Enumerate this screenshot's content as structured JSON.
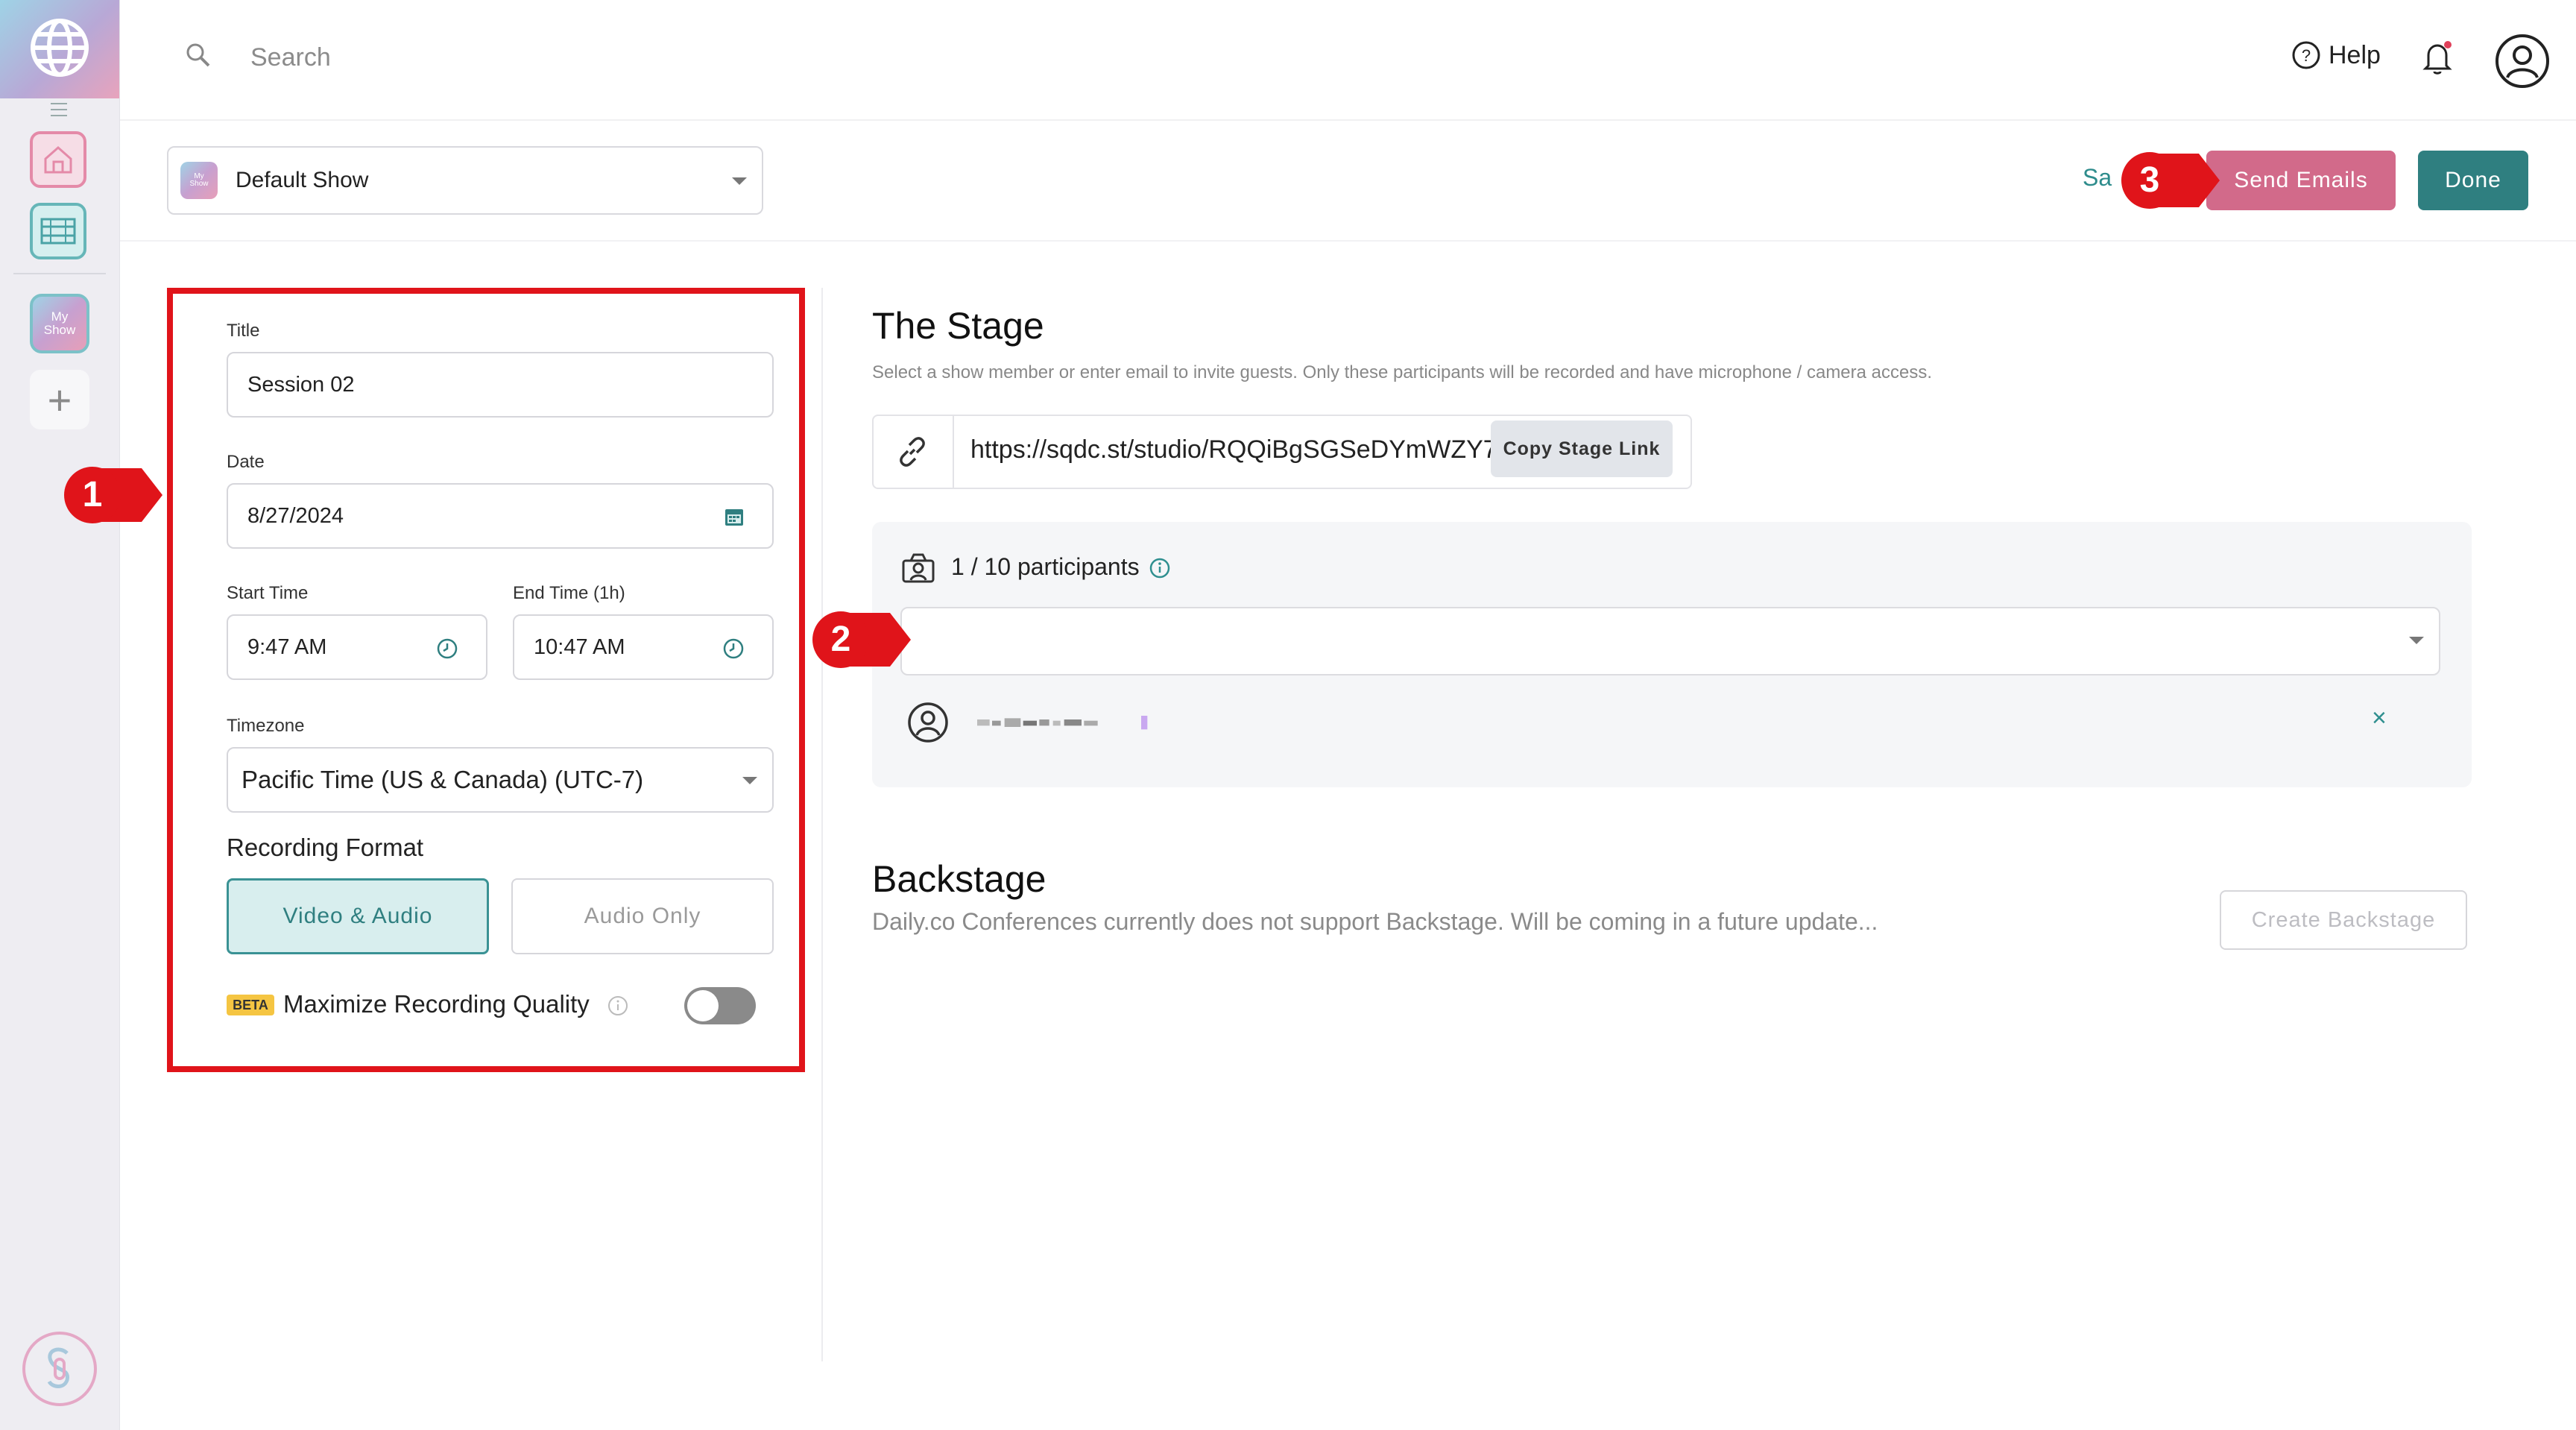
{
  "sidebar": {
    "show_tile_label": "My Show"
  },
  "topbar": {
    "search_placeholder": "Search",
    "help_label": "Help"
  },
  "header": {
    "show_select_value": "Default Show",
    "show_mini_label": "My Show",
    "save_partial": "Sa",
    "send_emails_label": "Send Emails",
    "done_label": "Done"
  },
  "form": {
    "title_label": "Title",
    "title_value": "Session 02",
    "date_label": "Date",
    "date_value": "8/27/2024",
    "start_time_label": "Start Time",
    "start_time_value": "9:47 AM",
    "end_time_label": "End Time (1h)",
    "end_time_value": "10:47 AM",
    "timezone_label": "Timezone",
    "timezone_value": "Pacific Time (US & Canada) (UTC-7)",
    "recording_format_label": "Recording Format",
    "format_options": [
      "Video & Audio",
      "Audio Only"
    ],
    "format_selected": "Video & Audio",
    "beta_badge": "BETA",
    "max_quality_label": "Maximize Recording Quality",
    "max_quality_enabled": false
  },
  "stage": {
    "heading": "The Stage",
    "subtitle": "Select a show member or enter email to invite guests. Only these participants will be recorded and have microphone / camera access.",
    "link_url": "https://sqdc.st/studio/RQQiBgSGSeDYmWZY7",
    "copy_link_label": "Copy Stage Link",
    "participants_count": "1 / 10 participants",
    "remove_icon": "×"
  },
  "backstage": {
    "heading": "Backstage",
    "subtitle": "Daily.co Conferences currently does not support Backstage. Will be coming in a future update...",
    "create_label": "Create Backstage"
  },
  "annotations": {
    "marker_1": "1",
    "marker_2": "2",
    "marker_3": "3"
  },
  "colors": {
    "accent_teal": "#2f7f80",
    "send_pink": "#d26a8a",
    "highlight_red": "#e0141a",
    "selected_segment_bg": "#d8eeee"
  }
}
